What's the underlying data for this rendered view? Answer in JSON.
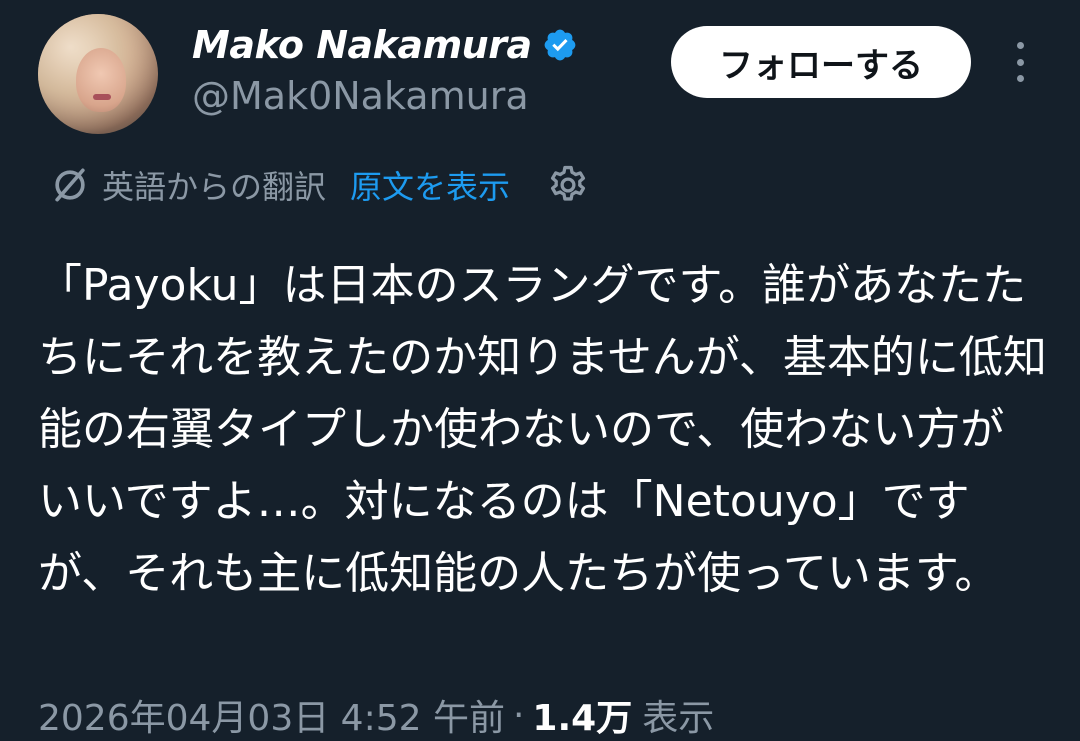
{
  "author": {
    "name": "Mako Nakamura",
    "handle": "@Mak0Nakamura",
    "verified": true
  },
  "follow_button": {
    "label": "フォローする"
  },
  "translation": {
    "label": "英語からの翻訳",
    "show_original_label": "原文を表示"
  },
  "tweet": {
    "text": "「Payoku」は日本のスラングです。誰があなたたちにそれを教えたのか知りませんが、基本的に低知能の右翼タイプしか使わないので、使わない方がいいですよ…。対になるのは「Netouyo」ですが、それも主に低知能の人たちが使っています。"
  },
  "meta": {
    "timestamp": "2026年04月03日 4:52 午前",
    "separator": "·",
    "views_count": "1.4万",
    "views_label": "表示"
  },
  "colors": {
    "background": "#15202b",
    "accent": "#1d9bf0",
    "secondary_text": "#8b98a5",
    "verified_badge": "#1d9bf0"
  }
}
